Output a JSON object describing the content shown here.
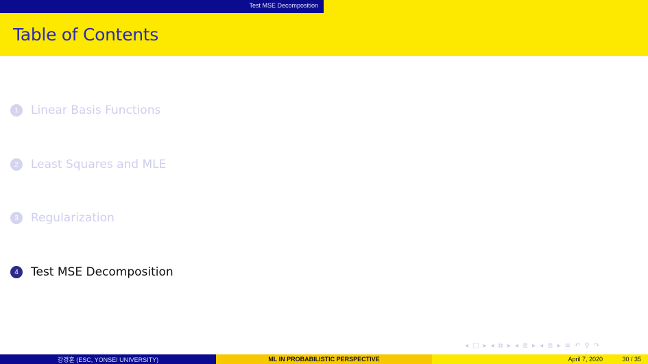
{
  "header": {
    "section": "Test MSE Decomposition"
  },
  "frame": {
    "title": "Table of Contents"
  },
  "toc": [
    {
      "number": "1",
      "label": "Linear Basis Functions",
      "active": false
    },
    {
      "number": "2",
      "label": "Least Squares and MLE",
      "active": false
    },
    {
      "number": "3",
      "label": "Regularization",
      "active": false
    },
    {
      "number": "4",
      "label": "Test MSE Decomposition",
      "active": true
    }
  ],
  "navigation": {
    "icons": [
      "nav-prev-frame-icon",
      "nav-next-frame-icon",
      "nav-prev-subsection-icon",
      "nav-next-subsection-icon",
      "nav-prev-section-icon",
      "nav-next-section-icon",
      "nav-search-icon"
    ]
  },
  "footer": {
    "author": "강경훈 (ESC, YONSEI UNIVERSITY)",
    "title": "ML IN PROBABILISTIC PERSPECTIVE",
    "date": "April 7, 2020",
    "page": "30 / 35"
  },
  "colors": {
    "beamer_yellow": "#fde900",
    "beamer_navy": "#0b0b8f",
    "title_blue": "#2b2bb0",
    "footer_gold": "#f7c800"
  }
}
